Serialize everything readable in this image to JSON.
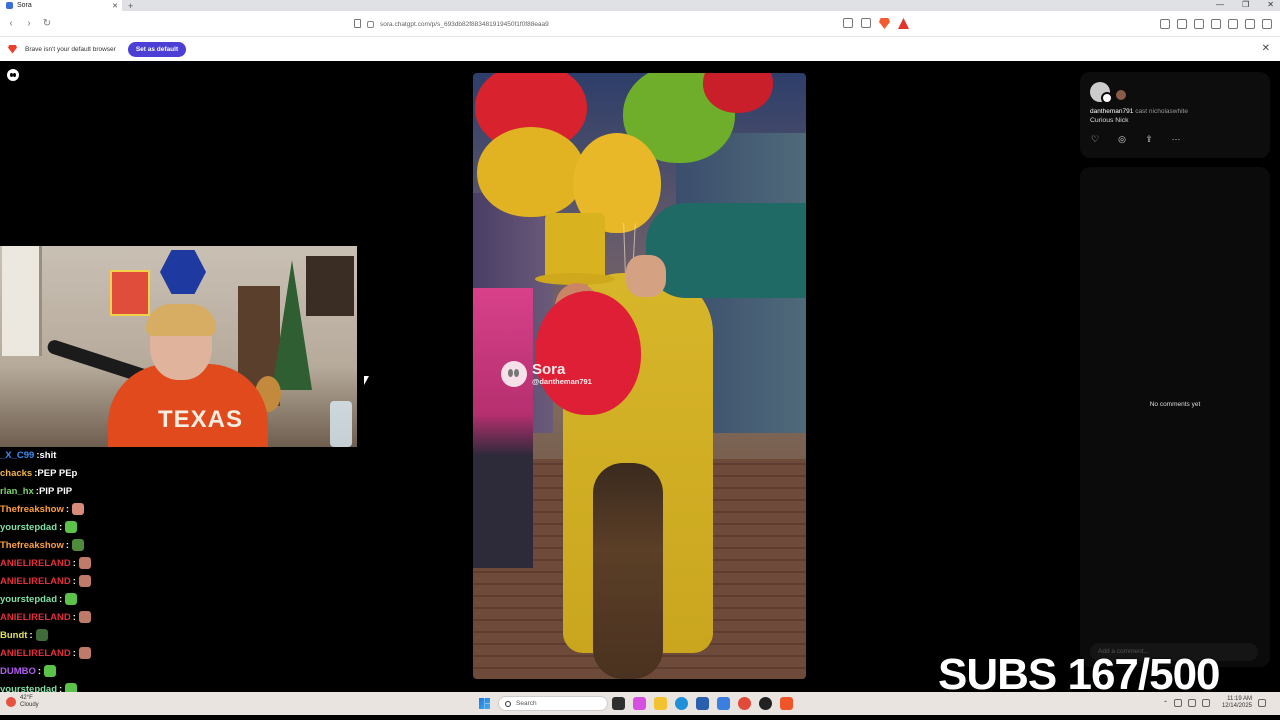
{
  "browser": {
    "tab_title": "Sora",
    "new_tab": "+",
    "url": "sora.chatgpt.com/p/s_693db82f883481919450f1f0f88eaa9",
    "notice_text": "Brave isn't your default browser",
    "notice_button": "Set as default",
    "window_controls": [
      "—",
      "❐",
      "✕"
    ]
  },
  "video": {
    "watermark_title": "Sora",
    "watermark_handle": "@dantheman791"
  },
  "post": {
    "author": "dantheman791",
    "cast_label": "cast",
    "cast_user": "nicholaswhite",
    "caption": "Curious Nick"
  },
  "comments": {
    "empty_text": "No comments yet",
    "add_placeholder": "Add a comment..."
  },
  "chat": [
    {
      "user": "_X_C99",
      "color": "#3b8df7",
      "msg": "shit",
      "emote": ""
    },
    {
      "user": "chacks",
      "color": "#f4b648",
      "msg": "PEP PEp",
      "emote": ""
    },
    {
      "user": "rlan_hx",
      "color": "#7ad46a",
      "msg": "PIP PIP",
      "emote": ""
    },
    {
      "user": "Thefreakshow",
      "color": "#ff9f3a",
      "msg": "",
      "emote": "#d98b7a"
    },
    {
      "user": "yourstepdad",
      "color": "#7fe0a6",
      "msg": "",
      "emote": "#5bc24a"
    },
    {
      "user": "Thefreakshow",
      "color": "#ff9f3a",
      "msg": "",
      "emote": "#4f8a3a"
    },
    {
      "user": "ANIELIRELAND",
      "color": "#e0303a",
      "msg": "",
      "emote": "#c07a6a"
    },
    {
      "user": "ANIELIRELAND",
      "color": "#e0303a",
      "msg": "",
      "emote": "#c07a6a"
    },
    {
      "user": "yourstepdad",
      "color": "#7fe0a6",
      "msg": "",
      "emote": "#5bc24a"
    },
    {
      "user": "ANIELIRELAND",
      "color": "#e0303a",
      "msg": "",
      "emote": "#c07a6a"
    },
    {
      "user": "Bundt",
      "color": "#e5e05a",
      "msg": "",
      "emote": "#3f6a3a"
    },
    {
      "user": "ANIELIRELAND",
      "color": "#e0303a",
      "msg": "",
      "emote": "#c07a6a"
    },
    {
      "user": "DUMBO",
      "color": "#b05cf0",
      "msg": "",
      "emote": "#5bc24a"
    },
    {
      "user": "yourstepdad",
      "color": "#7fe0a6",
      "msg": "",
      "emote": "#5bc24a"
    }
  ],
  "overlay": {
    "subs_label": "SUBS 167/500"
  },
  "taskbar": {
    "weather_temp": "42°F",
    "weather_desc": "Cloudy",
    "search_placeholder": "Search",
    "time": "11:19 AM",
    "date": "12/14/2025"
  }
}
